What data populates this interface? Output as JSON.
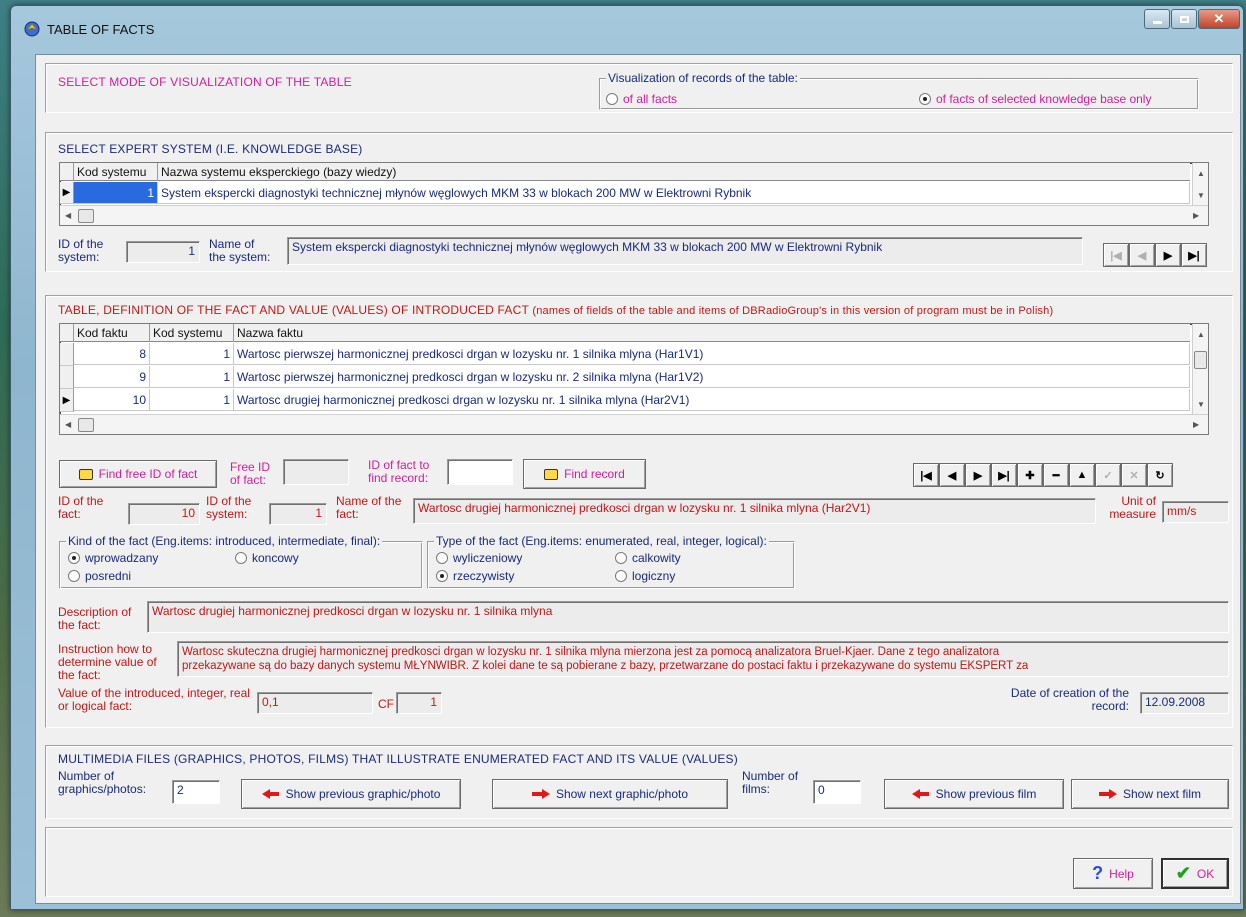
{
  "window": {
    "title": "TABLE OF FACTS"
  },
  "mode_section": {
    "title": "SELECT MODE OF VISUALIZATION OF THE TABLE",
    "group_label": "Visualization of records of the table:",
    "options": [
      {
        "label": "of all facts",
        "selected": false
      },
      {
        "label": "of facts of selected knowledge base only",
        "selected": true
      }
    ]
  },
  "expert_section": {
    "title": "SELECT EXPERT SYSTEM (I.E. KNOWLEDGE BASE)",
    "columns": [
      "Kod systemu",
      "Nazwa systemu eksperckiego (bazy wiedzy)"
    ],
    "rows": [
      {
        "kod": "1",
        "nazwa": "System ekspercki diagnostyki technicznej młynów węglowych MKM 33 w blokach 200 MW w Elektrowni Rybnik"
      }
    ],
    "id_label": "ID of the system:",
    "id_value": "1",
    "name_label": "Name of the system:",
    "name_value": "System ekspercki diagnostyki technicznej młynów węglowych MKM 33 w blokach 200 MW w Elektrowni Rybnik",
    "nav": [
      "first",
      "prior",
      "next",
      "last"
    ]
  },
  "fact_section": {
    "title": "TABLE, DEFINITION OF THE FACT AND VALUE (VALUES) OF INTRODUCED FACT",
    "title_note": "(names of fields of the table and items of DBRadioGroup's in this version of program must be in Polish)",
    "columns": [
      "Kod faktu",
      "Kod systemu",
      "Nazwa faktu"
    ],
    "rows": [
      {
        "kod_faktu": "8",
        "kod_systemu": "1",
        "nazwa": "Wartosc pierwszej harmonicznej predkosci drgan w lozysku nr. 1 silnika mlyna (Har1V1)"
      },
      {
        "kod_faktu": "9",
        "kod_systemu": "1",
        "nazwa": "Wartosc pierwszej harmonicznej predkosci drgan w lozysku nr. 2 silnika mlyna (Har1V2)"
      },
      {
        "kod_faktu": "10",
        "kod_systemu": "1",
        "nazwa": "Wartosc drugiej harmonicznej predkosci drgan w lozysku nr. 1 silnika mlyna (Har2V1)"
      }
    ],
    "find_free_button": "Find free ID of fact",
    "free_id_label": "Free ID of fact:",
    "free_id_value": "",
    "find_id_label": "ID of fact to find record:",
    "find_id_value": "",
    "find_record_button": "Find record",
    "fact_id_label": "ID of the fact:",
    "fact_id_value": "10",
    "system_id_label": "ID of the system:",
    "system_id_value": "1",
    "fact_name_label": "Name of the fact:",
    "fact_name_value": "Wartosc drugiej harmonicznej predkosci drgan w lozysku nr. 1 silnika mlyna (Har2V1)",
    "unit_label": "Unit of measure",
    "unit_value": "mm/s",
    "kind_group": {
      "label": "Kind of the fact (Eng.items: introduced, intermediate, final):",
      "options": [
        {
          "label": "wprowadzany",
          "selected": true
        },
        {
          "label": "koncowy",
          "selected": false
        },
        {
          "label": "posredni",
          "selected": false
        }
      ]
    },
    "type_group": {
      "label": "Type of the fact (Eng.items: enumerated, real, integer, logical):",
      "options": [
        {
          "label": "wyliczeniowy",
          "selected": false
        },
        {
          "label": "calkowity",
          "selected": false
        },
        {
          "label": "rzeczywisty",
          "selected": true
        },
        {
          "label": "logiczny",
          "selected": false
        }
      ]
    },
    "description_label": "Description of the fact:",
    "description_value": "Wartosc drugiej harmonicznej predkosci drgan w lozysku nr. 1 silnika mlyna",
    "instruction_label": "Instruction how to determine value of the fact:",
    "instruction_line1": "Wartosc skuteczna drugiej harmonicznej predkosci drgan w lozysku nr. 1 silnika mlyna mierzona jest za pomocą analizatora Bruel-Kjaer. Dane z tego analizatora",
    "instruction_line2": "przekazywane są do bazy danych systemu MŁYNWIBR. Z kolei dane te są pobierane z bazy, przetwarzane do postaci faktu i przekazywane do systemu EKSPERT za",
    "value_label": "Value of the introduced, integer, real or logical fact:",
    "value_value": "0,1",
    "cf_label": "CF",
    "cf_value": "1",
    "date_label": "Date of creation of the record:",
    "date_value": "12.09.2008"
  },
  "multimedia_section": {
    "title": "MULTIMEDIA FILES (GRAPHICS, PHOTOS, FILMS) THAT ILLUSTRATE ENUMERATED FACT AND ITS VALUE (VALUES)",
    "graphics_label": "Number of graphics/photos:",
    "graphics_value": "2",
    "prev_graphic": "Show previous graphic/photo",
    "next_graphic": "Show next graphic/photo",
    "films_label": "Number of films:",
    "films_value": "0",
    "prev_film": "Show previous film",
    "next_film": "Show next film"
  },
  "footer": {
    "help": "Help",
    "ok": "OK"
  },
  "colors": {
    "accent_pink": "#d0209a",
    "text_navy": "#1a2a7a",
    "text_red": "#c01818",
    "grid_select": "#2a6adf"
  }
}
